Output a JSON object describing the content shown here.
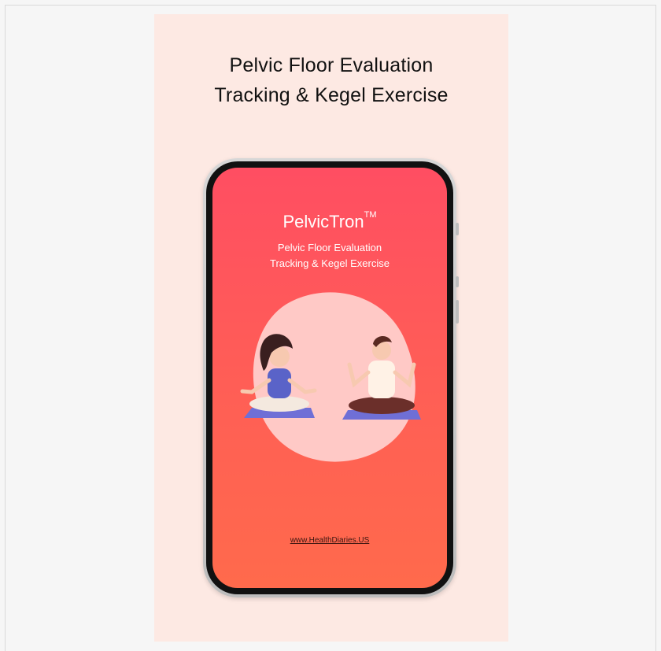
{
  "poster": {
    "headline_line1": "Pelvic Floor Evaluation",
    "headline_line2": "Tracking & Kegel Exercise"
  },
  "app": {
    "name": "PelvicTron",
    "trademark": "TM",
    "subtitle_line1": "Pelvic Floor Evaluation",
    "subtitle_line2": "Tracking & Kegel Exercise",
    "website": "www.HealthDiaries.US"
  },
  "colors": {
    "poster_bg": "#fde9e3",
    "screen_top": "#ff4e62",
    "screen_bottom": "#ff6a4c",
    "mat": "#6f6fd6"
  },
  "icons": [
    "woman-meditating-illustration",
    "man-meditating-illustration"
  ]
}
